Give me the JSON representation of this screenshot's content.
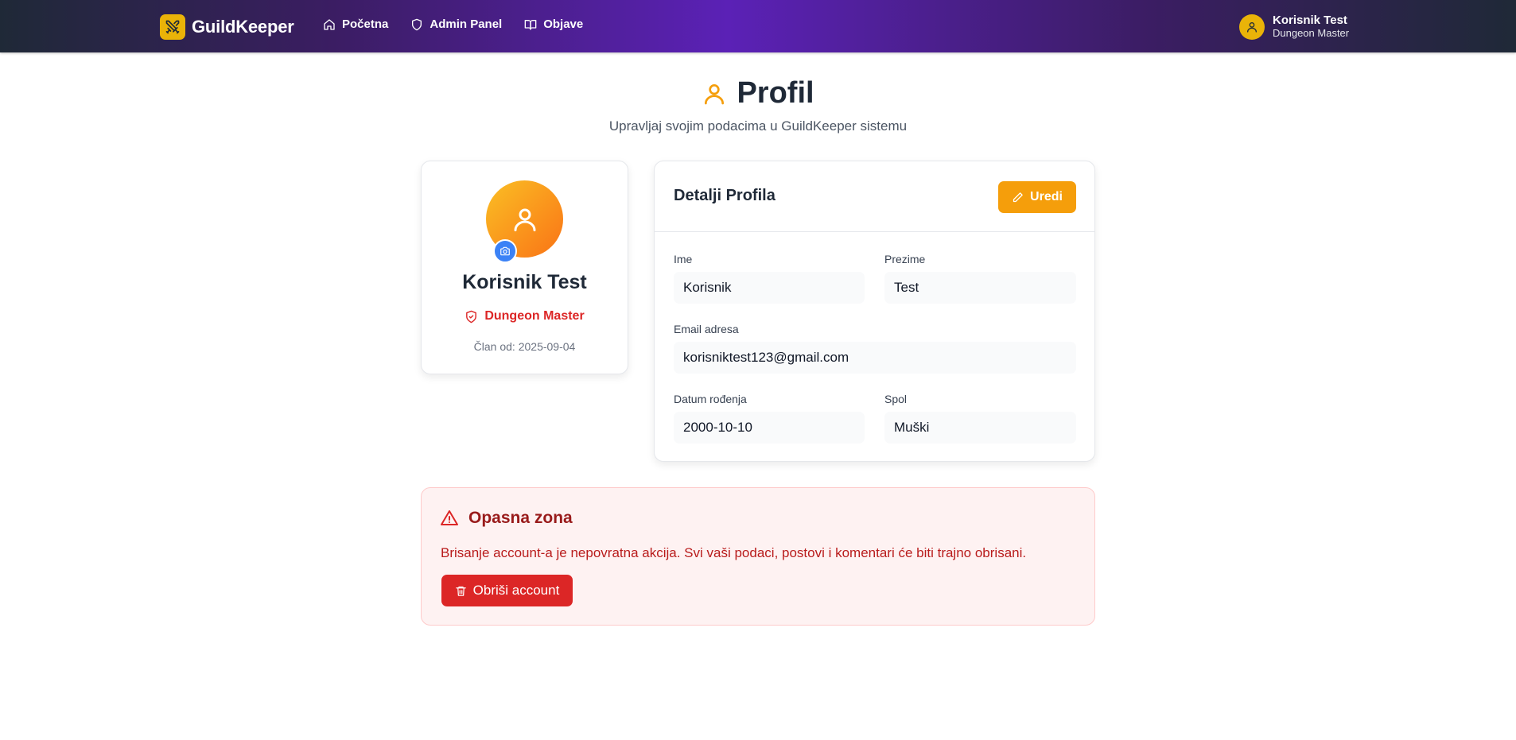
{
  "app": {
    "brand": "GuildKeeper",
    "brand_color": "#eab308"
  },
  "nav": {
    "links": [
      {
        "label": "Početna",
        "icon": "home-icon"
      },
      {
        "label": "Admin Panel",
        "icon": "shield-icon"
      },
      {
        "label": "Objave",
        "icon": "book-icon"
      }
    ]
  },
  "user": {
    "name": "Korisnik Test",
    "role": "Dungeon Master"
  },
  "header": {
    "title": "Profil",
    "subtitle": "Upravljaj svojim podacima u GuildKeeper sistemu"
  },
  "profile_card": {
    "name": "Korisnik Test",
    "role": "Dungeon Master",
    "member_since": "Član od: 2025-09-04"
  },
  "details": {
    "title": "Detalji Profila",
    "edit_label": "Uredi",
    "fields": {
      "first_name": {
        "label": "Ime",
        "value": "Korisnik"
      },
      "last_name": {
        "label": "Prezime",
        "value": "Test"
      },
      "email": {
        "label": "Email adresa",
        "value": "korisniktest123@gmail.com"
      },
      "birth_date": {
        "label": "Datum rođenja",
        "value": "2000-10-10"
      },
      "gender": {
        "label": "Spol",
        "value": "Muški"
      }
    }
  },
  "danger": {
    "title": "Opasna zona",
    "text": "Brisanje account-a je nepovratna akcija. Svi vaši podaci, postovi i komentari će biti trajno obrisani.",
    "delete_label": "Obriši account"
  },
  "colors": {
    "accent": "#f59e0b",
    "danger": "#dc2626",
    "camera": "#3b82f6"
  }
}
